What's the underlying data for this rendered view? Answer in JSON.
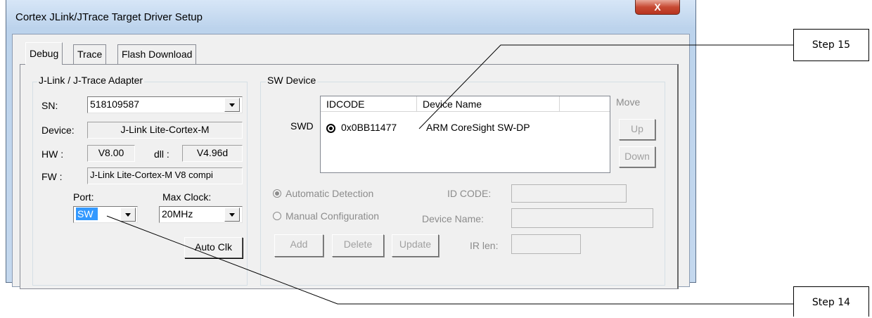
{
  "window": {
    "title": "Cortex JLink/JTrace Target Driver Setup",
    "close_glyph": "X"
  },
  "tabs": [
    "Debug",
    "Trace",
    "Flash Download"
  ],
  "adapter": {
    "group_title": "J-Link / J-Trace Adapter",
    "sn_label": "SN:",
    "sn_value": "518109587",
    "device_label": "Device:",
    "device_value": "J-Link Lite-Cortex-M",
    "hw_label": "HW :",
    "hw_value": "V8.00",
    "dll_label": "dll :",
    "dll_value": "V4.96d",
    "fw_label": "FW :",
    "fw_value": "J-Link Lite-Cortex-M V8 compi",
    "port_label": "Port:",
    "port_value": "SW",
    "maxclock_label": "Max Clock:",
    "maxclock_value": "20MHz",
    "autoclk_label": "Auto Clk"
  },
  "sw_device": {
    "group_title": "SW Device",
    "columns": [
      "IDCODE",
      "Device Name"
    ],
    "row_prefix": "SWD",
    "rows": [
      {
        "idcode": "0x0BB11477",
        "device_name": "ARM CoreSight SW-DP"
      }
    ],
    "move_label": "Move",
    "up_label": "Up",
    "down_label": "Down",
    "automatic_detection": "Automatic Detection",
    "manual_configuration": "Manual Configuration",
    "id_code_label": "ID CODE:",
    "device_name_label": "Device Name:",
    "add_label": "Add",
    "delete_label": "Delete",
    "update_label": "Update",
    "ir_len_label": "IR len:"
  },
  "callouts": {
    "step15": "Step 15",
    "step14": "Step 14"
  }
}
